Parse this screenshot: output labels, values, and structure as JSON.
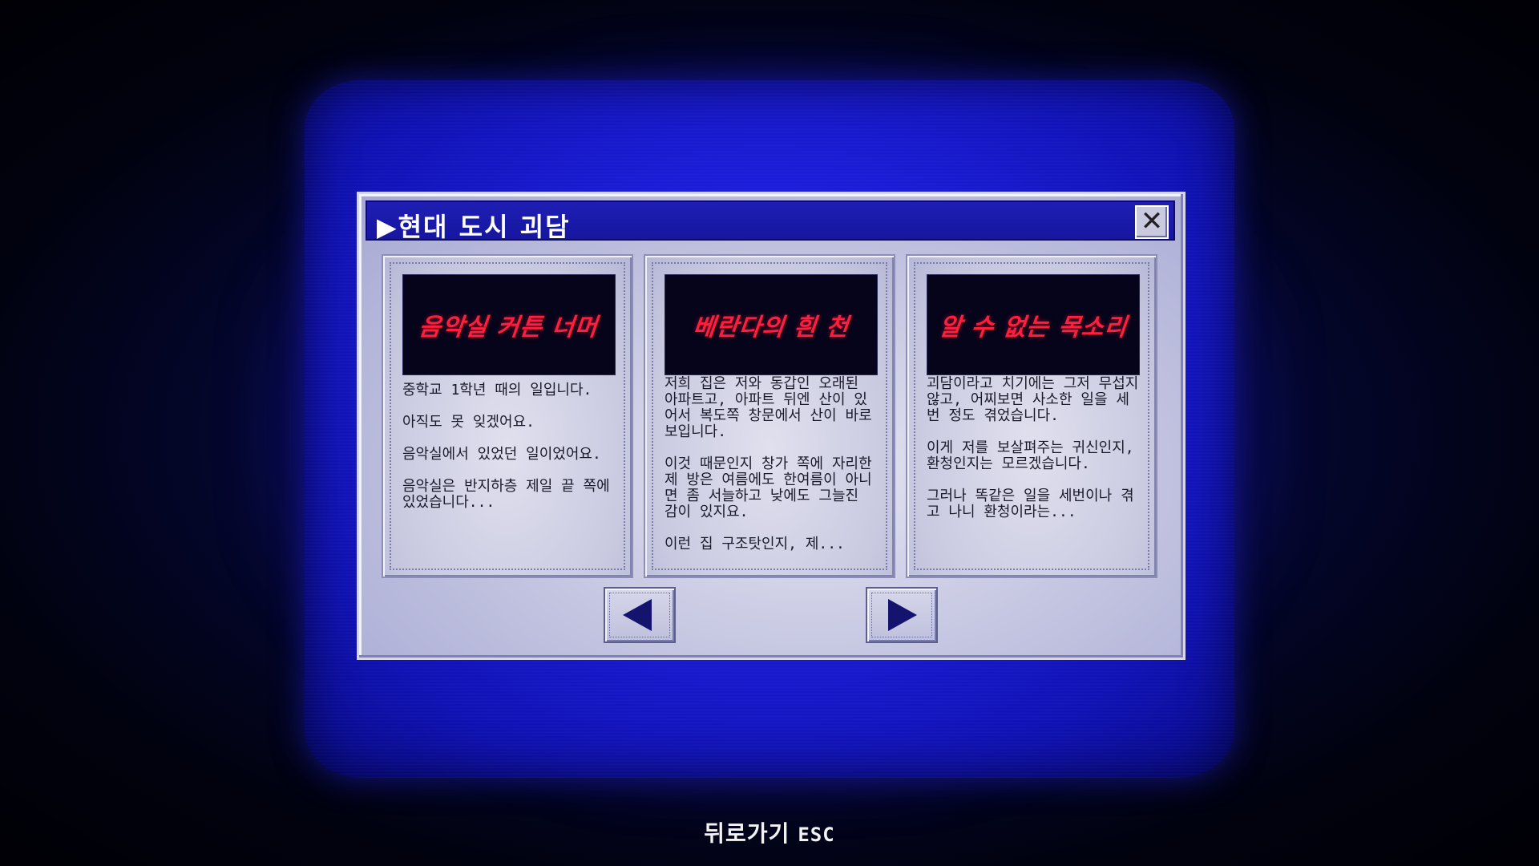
{
  "window": {
    "title": "▶현대 도시 괴담",
    "close_label": "✕"
  },
  "cards": [
    {
      "title": "음악실 커튼 너머",
      "paragraphs": [
        "중학교 1학년 때의 일입니다.",
        "아직도 못 잊겠어요.",
        "음악실에서 있었던 일이었어요.",
        "음악실은 반지하층 제일 끝 쪽에 있었습니다..."
      ]
    },
    {
      "title": "베란다의 흰 천",
      "paragraphs": [
        "저희 집은 저와 동갑인 오래된 아파트고, 아파트 뒤엔 산이 있어서 복도쪽 창문에서 산이 바로 보입니다.",
        "이것 때문인지 창가 쪽에 자리한 제 방은 여름에도 한여름이 아니면 좀 서늘하고 낮에도 그늘진 감이 있지요.",
        "이런 집 구조탓인지, 제..."
      ]
    },
    {
      "title": "알 수 없는 목소리",
      "paragraphs": [
        "괴담이라고 치기에는 그저 무섭지 않고, 어찌보면 사소한 일을 세번 정도 겪었습니다.",
        "이게 저를 보살펴주는 귀신인지, 환청인지는 모르겠습니다.",
        "그러나 똑같은 일을 세번이나 겪고 나니 환청이라는..."
      ]
    }
  ],
  "nav": {
    "prev_icon": "left-arrow-icon",
    "next_icon": "right-arrow-icon"
  },
  "footer": {
    "back_label": "뒤로가기",
    "back_key": "ESC"
  },
  "colors": {
    "title_bar": "#1616a0",
    "card_title": "#ff1e3c",
    "screen": "#1b1dd8"
  }
}
